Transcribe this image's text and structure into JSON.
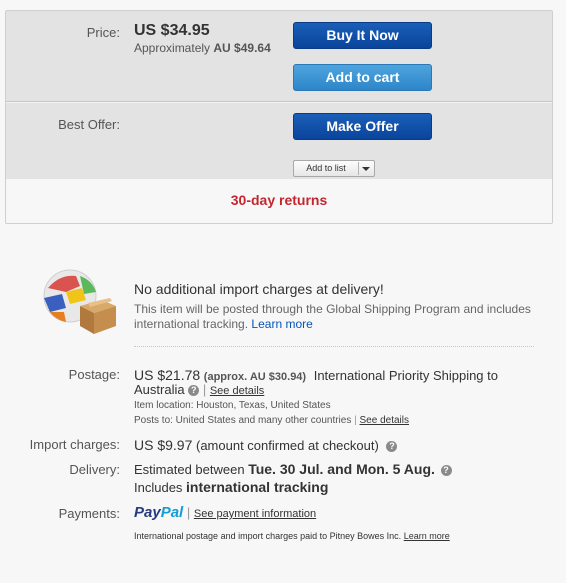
{
  "buy_box": {
    "price_label": "Price:",
    "price": "US $34.95",
    "approx_prefix": "Approximately",
    "approx_value": "AU $49.64",
    "buy_now_label": "Buy It Now",
    "add_to_cart_label": "Add to cart",
    "best_offer_label": "Best Offer:",
    "make_offer_label": "Make Offer",
    "add_to_list_label": "Add to list",
    "returns": "30-day returns"
  },
  "global_shipping": {
    "title": "No additional import charges at delivery!",
    "desc": "This item will be posted through the Global Shipping Program and includes international tracking.",
    "learn_more": "Learn more"
  },
  "postage": {
    "label": "Postage:",
    "amount": "US $21.78",
    "approx": "(approx. AU $30.94)",
    "service_line1": "International Priority Shipping to",
    "service_line2": "Australia",
    "see_details": "See details",
    "location": "Item location:  Houston, Texas, United States",
    "posts_to": "Posts to:  United States and many other countries",
    "see_details2": "See details"
  },
  "import": {
    "label": "Import charges:",
    "amount": "US $9.97",
    "note": "(amount confirmed at checkout)"
  },
  "delivery": {
    "label": "Delivery:",
    "prefix": "Estimated between",
    "range": "Tue. 30 Jul. and Mon. 5 Aug.",
    "includes": "Includes",
    "tracking": "international tracking"
  },
  "payments": {
    "label": "Payments:",
    "paypal_1": "Pay",
    "paypal_2": "Pal",
    "see_info": "See payment information",
    "footnote": "International postage and import charges paid to Pitney Bowes Inc.",
    "footnote_link": "Learn more"
  },
  "colors": {
    "button_dark": "#0a449b",
    "button_light": "#2d86c9",
    "returns_red": "#c4262e",
    "link_blue": "#0654ba"
  },
  "icons": [
    "globe-box-icon",
    "help-icon",
    "dropdown-arrow-icon"
  ]
}
